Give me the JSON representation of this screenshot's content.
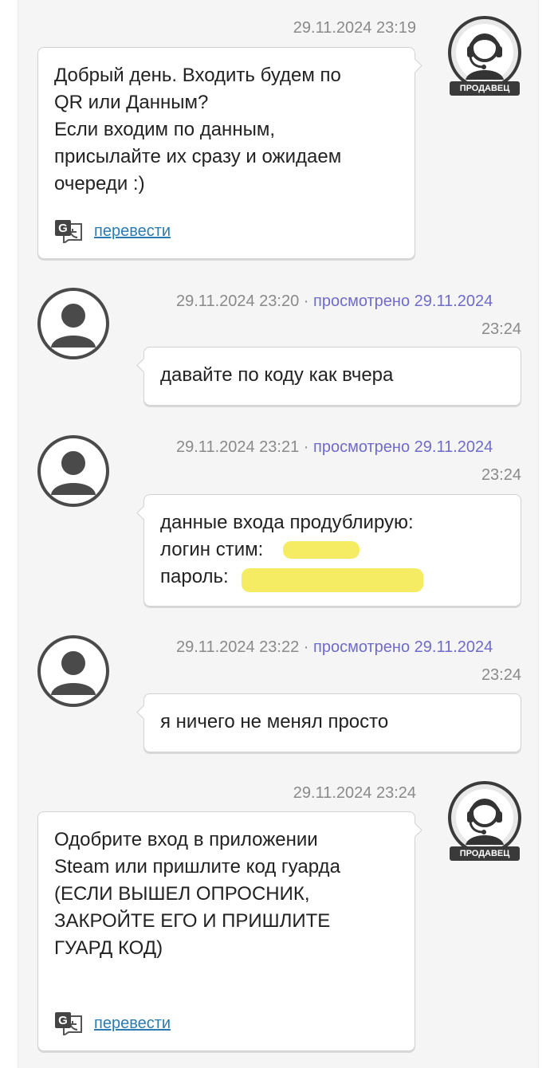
{
  "seller_badge": "ПРОДАВЕЦ",
  "messages": [
    {
      "time": "29.11.2024 23:19",
      "lines": [
        "Добрый день. Входить будем по",
        "QR или Данным?",
        "Если входим по данным,",
        "присылайте их сразу и ожидаем",
        "очереди :)"
      ],
      "translate": "перевести"
    },
    {
      "time": "29.11.2024 23:20",
      "seen": "просмотрено 29.11.2024",
      "seen_time": "23:24",
      "text": "давайте по коду как вчера"
    },
    {
      "time": "29.11.2024 23:21",
      "seen": "просмотрено 29.11.2024",
      "seen_time": "23:24",
      "lines": [
        "данные входа продублирую:",
        "логин стим:",
        "пароль:"
      ]
    },
    {
      "time": "29.11.2024 23:22",
      "seen": "просмотрено 29.11.2024",
      "seen_time": "23:24",
      "text": "я ничего не менял просто"
    },
    {
      "time": "29.11.2024 23:24",
      "lines": [
        "Одобрите вход в приложении",
        "Steam или пришлите код гуарда",
        "(ЕСЛИ ВЫШЕЛ ОПРОСНИК,",
        "ЗАКРОЙТЕ ЕГО И ПРИШЛИТЕ",
        "ГУАРД КОД)"
      ],
      "translate": "перевести"
    }
  ],
  "separator": "·",
  "colors": {
    "seen": "#6f6bc9",
    "link": "#2b7bb0",
    "redaction": "#f6ec63"
  },
  "icons": {
    "translate": "google-translate-icon",
    "seller_avatar": "support-headset-icon",
    "user_avatar": "user-silhouette-icon"
  }
}
